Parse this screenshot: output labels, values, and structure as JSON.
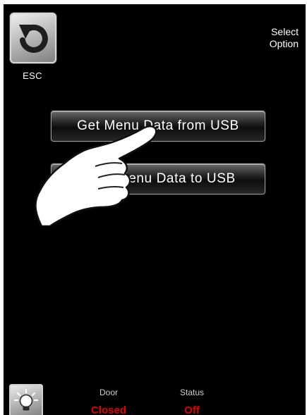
{
  "header": {
    "esc_label": "ESC",
    "prompt_line1": "Select",
    "prompt_line2": "Option"
  },
  "menu": {
    "items": [
      {
        "label": "Get Menu Data from USB"
      },
      {
        "label": "Save Menu Data to USB"
      }
    ]
  },
  "footer": {
    "door": {
      "label": "Door",
      "value": "Closed"
    },
    "status": {
      "label": "Status",
      "value": "Off"
    }
  },
  "colors": {
    "background": "#000000",
    "text": "#ffffff",
    "status_value": "#e00000"
  },
  "icons": {
    "esc": "undo-arrow-icon",
    "pointer": "pointing-hand-icon",
    "light": "light-bulb-icon"
  }
}
